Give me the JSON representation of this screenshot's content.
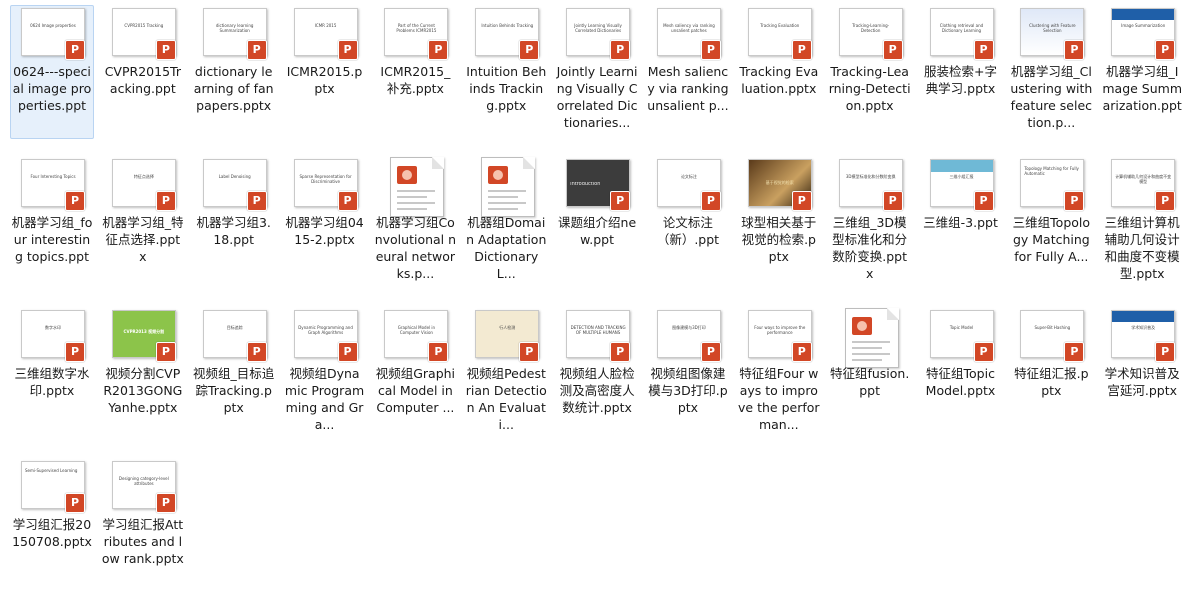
{
  "window": {
    "title": "File Explorer - large icons view"
  },
  "files": [
    {
      "name": "0624---special image properties.ppt",
      "slide": "0624 Image properties",
      "selected": true
    },
    {
      "name": "CVPR2015Tracking.ppt",
      "slide": "CVPR2015 Tracking"
    },
    {
      "name": "dictionary learning of fan papers.pptx",
      "slide": "dictionary learning Summarization"
    },
    {
      "name": "ICMR2015.pptx",
      "slide": "ICMR 2015"
    },
    {
      "name": "ICMR2015_补充.pptx",
      "slide": "Part of the Current Problems ICMR2015"
    },
    {
      "name": "Intuition Behinds Tracking.pptx",
      "slide": "Intuition Behinds Tracking"
    },
    {
      "name": "Jointly Learning Visually Correlated Dictionaries...",
      "slide": "Jointly Learning Visually Correlated Dictionaries"
    },
    {
      "name": "Mesh saliency via ranking unsalient p...",
      "slide": "Mesh saliency via ranking unsalient patches"
    },
    {
      "name": "Tracking Evaluation.pptx",
      "slide": "Tracking Evaluation"
    },
    {
      "name": "Tracking-Learning-Detection.pptx",
      "slide": "Tracking-Learning-Detection"
    },
    {
      "name": "服装检索+字典学习.pptx",
      "slide": "Clothing retrieval and Dictionary Learning"
    },
    {
      "name": "机器学习组_Clustering with feature selection.p...",
      "slide": "Clustering with Feature Selection"
    },
    {
      "name": "机器学习组_Image Summarization.ppt",
      "slide": "Image Summarization"
    },
    {
      "name": "机器学习组_four interesting topics.ppt",
      "slide": "Four Interesting Topics"
    },
    {
      "name": "机器学习组_特征点选择.pptx",
      "slide": "特征点选择"
    },
    {
      "name": "机器学习组3.18.ppt",
      "slide": "Label Denoising"
    },
    {
      "name": "机器学习组0415-2.pptx",
      "slide": "Sparse Representation for Discriminative"
    },
    {
      "name": "机器学习组Convolutional neural networks.p...",
      "slide": ""
    },
    {
      "name": "机器组Domain AdaptationDictionary L...",
      "slide": ""
    },
    {
      "name": "课题组介绍new.ppt",
      "slide": "Introduction"
    },
    {
      "name": "论文标注（新）.ppt",
      "slide": "论文标注"
    },
    {
      "name": "球型相关基于视觉的检索.pptx",
      "slide": "基于视觉的检索"
    },
    {
      "name": "三维组_3D模型标准化和分数阶变换.pptx",
      "slide": "3D模型标准化和分数阶变换"
    },
    {
      "name": "三维组-3.ppt",
      "slide": "三维小组汇报"
    },
    {
      "name": "三维组Topology Matching for Fully A...",
      "slide": "Topology Matching for Fully Automatic"
    },
    {
      "name": "三维组计算机辅助几何设计和曲度不变模型.pptx",
      "slide": "计算机辅助几何设计和曲度不变模型"
    },
    {
      "name": "三维组数字水印.pptx",
      "slide": "数字水印"
    },
    {
      "name": "视频分割CVPR2013GONGYanhe.pptx",
      "slide": "CVPR2013 视频分割"
    },
    {
      "name": "视频组_目标追踪Tracking.pptx",
      "slide": "目标追踪"
    },
    {
      "name": "视频组Dynamic Programming and Gra...",
      "slide": "Dynamic Programming and Graph Algorithms"
    },
    {
      "name": "视频组Graphical Model in Computer ...",
      "slide": "Graphical Model in Computer Vision"
    },
    {
      "name": "视频组Pedestrian Detection An Evaluati...",
      "slide": "行人检测"
    },
    {
      "name": "视频组人脸检测及高密度人数统计.pptx",
      "slide": "DETECTION AND TRACKING OF MULTIPLE HUMANS"
    },
    {
      "name": "视频组图像建模与3D打印.pptx",
      "slide": "图像建模与3D打印"
    },
    {
      "name": "特征组Four ways to improve the performan...",
      "slide": "Four ways to improve the performance"
    },
    {
      "name": "特征组fusion.ppt",
      "slide": ""
    },
    {
      "name": "特征组Topic Model.pptx",
      "slide": "Topic Model"
    },
    {
      "name": "特征组汇报.pptx",
      "slide": "Super-Bit Hashing"
    },
    {
      "name": "学术知识普及宫延河.pptx",
      "slide": "学术知识普及"
    },
    {
      "name": "学习组汇报20150708.pptx",
      "slide": "Semi-Supervised Learning"
    },
    {
      "name": "学习组汇报Attributes and low rank.pptx",
      "slide": "Designing category-level attributes"
    }
  ],
  "icons": {
    "ppt_badge": "P"
  },
  "colors": {
    "selection": "#e6f0fb",
    "ppt_red": "#d24726"
  }
}
